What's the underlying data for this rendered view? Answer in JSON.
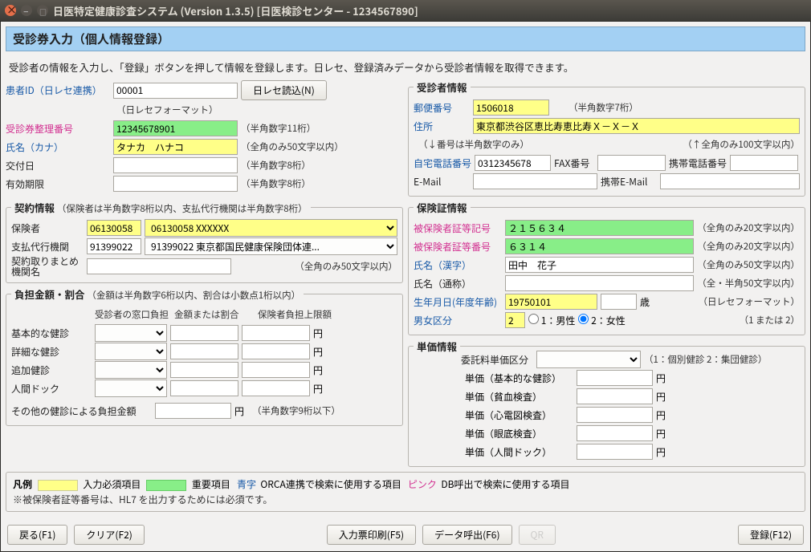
{
  "title": "日医特定健康診査システム (Version 1.3.5) [日医検診センター - 1234567890]",
  "banner": "受診券入力（個人情報登録）",
  "subtext": "受診者の情報を入力し、「登録」ボタンを押して情報を登録します。日レセ、登録済みデータから受診者情報を取得できます。",
  "left_patient": {
    "id_lbl": "患者ID（日レセ連携）",
    "id_val": "00001",
    "id_btn": "日レセ読込(N)",
    "id_fmt": "（日レセフォーマット）",
    "ticket_lbl": "受診券整理番号",
    "ticket_val": "12345678901",
    "ticket_hint": "（半角数字11桁）",
    "kana_lbl": "氏名（カナ）",
    "kana_val": "タナカ　ハナコ",
    "kana_hint": "（全角のみ50文字以内）",
    "issue_lbl": "交付日",
    "issue_hint": "（半角数字8桁）",
    "expiry_lbl": "有効期限",
    "expiry_hint": "（半角数字8桁）"
  },
  "contract": {
    "legend": "契約情報",
    "legend_hint": "（保険者は半角数字8桁以内、支払代行機関は半角数字8桁）",
    "insurer_lbl": "保険者",
    "insurer_code": "06130058",
    "insurer_name": "06130058 XXXXXX",
    "agency_lbl": "支払代行機関",
    "agency_code": "91399022",
    "agency_name": "91399022 東京都国民健康保険団体連...",
    "org_lbl1": "契約取りまとめ",
    "org_lbl2": "機関名",
    "org_hint": "（全角のみ50文字以内）"
  },
  "burden": {
    "legend": "負担金額・割合",
    "legend_hint": "（金額は半角数字6桁以内、割合は小数点1桁以内）",
    "col1": "受診者の窓口負担",
    "col2": "金額または割合",
    "col3": "保険者負担上限額",
    "row1": "基本的な健診",
    "row2": "詳細な健診",
    "row3": "追加健診",
    "row4": "人間ドック",
    "yen": "円",
    "other_lbl": "その他の健診による負担金額",
    "other_hint": "（半角数字9桁以下）"
  },
  "recipient": {
    "legend": "受診者情報",
    "zip_lbl": "郵便番号",
    "zip_val": "1506018",
    "zip_hint": "（半角数字7桁）",
    "addr_lbl": "住所",
    "addr_val": "東京都渋谷区恵比寿恵比寿Ｘ－Ｘ－Ｘ",
    "addr_hint_l": "（↓番号は半角数字のみ）",
    "addr_hint_r": "（↑全角のみ100文字以内）",
    "hometel_lbl": "自宅電話番号",
    "hometel_val": "0312345678",
    "fax_lbl": "FAX番号",
    "mobile_lbl": "携帯電話番号",
    "email_lbl": "E-Mail",
    "memail_lbl": "携帯E-Mail"
  },
  "insurance": {
    "legend": "保険証情報",
    "cert_sym_lbl": "被保険者証等記号",
    "cert_sym_val": "２１５６３４",
    "cert_sym_hint": "（全角のみ20文字以内）",
    "cert_no_lbl": "被保険者証等番号",
    "cert_no_val": "６３１４",
    "cert_no_hint": "（全角のみ20文字以内）",
    "kanji_lbl": "氏名（漢字）",
    "kanji_val": "田中　花子",
    "kanji_hint": "（全角のみ50文字以内）",
    "alias_lbl": "氏名（通称）",
    "alias_hint": "（全・半角50文字以内）",
    "dob_lbl": "生年月日(年度年齢)",
    "dob_val": "19750101",
    "age_unit": "歳",
    "dob_hint": "（日レセフォーマット）",
    "sex_lbl": "男女区分",
    "sex_val": "2",
    "sex_opt1": "1：男性",
    "sex_opt2": "2：女性",
    "sex_hint": "（1 または 2）"
  },
  "price": {
    "legend": "単価情報",
    "class_lbl": "委託料単価区分",
    "class_hint": "（1：個別健診 2：集団健診）",
    "r1": "単価（基本的な健診）",
    "r2": "単価（貧血検査）",
    "r3": "単価（心電図検査）",
    "r4": "単価（眼底検査）",
    "r5": "単価（人間ドック）",
    "yen": "円"
  },
  "legend": {
    "title": "凡例",
    "yellow_lbl": "入力必須項目",
    "green_lbl": "重要項目",
    "blue_lbl": "ORCA連携で検索に使用する項目",
    "blue_head": "青字",
    "pink_lbl": "DB呼出で検索に使用する項目",
    "pink_head": "ピンク",
    "note": "※被保険者証等番号は、HL7 を出力するためには必須です。"
  },
  "footer": {
    "back": "戻る(F1)",
    "clear": "クリア(F2)",
    "print": "入力票印刷(F5)",
    "recall": "データ呼出(F6)",
    "qr": "QR",
    "submit": "登録(F12)"
  }
}
